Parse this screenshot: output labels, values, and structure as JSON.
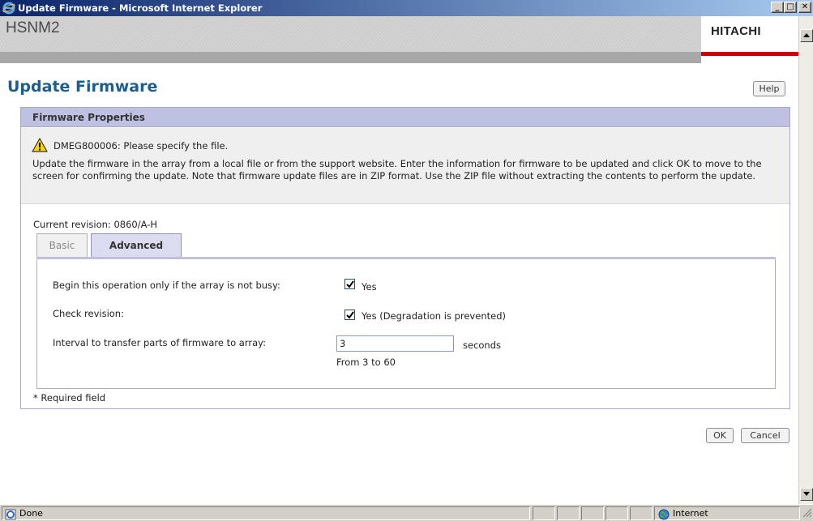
{
  "window": {
    "title": "Update Firmware - Microsoft Internet Explorer",
    "minimize_glyph": "_",
    "maximize_glyph": "□",
    "close_glyph": "✕"
  },
  "header": {
    "app_name": "HSNM2",
    "brand": "HITACHI"
  },
  "page": {
    "title": "Update Firmware",
    "help_label": "Help"
  },
  "panel": {
    "title": "Firmware Properties",
    "warning": "DMEG800006: Please specify the file.",
    "description": "Update the firmware in the array from a local file or from the support website.  Enter the information for firmware to be updated and click OK to move to the screen for confirming the update.  Note that firmware update files are in ZIP format. Use the ZIP file without extracting the contents to perform the update.",
    "current_revision": "Current revision: 0860/A-H",
    "tabs": [
      {
        "label": "Basic",
        "selected": false
      },
      {
        "label": "Advanced",
        "selected": true
      }
    ],
    "options": {
      "busy_label": "Begin this operation only if the array is not busy:",
      "busy_checked": true,
      "busy_value": "Yes",
      "check_revision_label": "Check revision:",
      "check_revision_checked": true,
      "check_revision_value": "Yes  (Degradation is prevented)",
      "interval_label": "Interval to transfer parts of firmware to array:",
      "interval_value": "3",
      "interval_unit": "seconds",
      "interval_range": "From 3 to 60"
    },
    "required_note": "* Required field"
  },
  "buttons": {
    "ok": "OK",
    "cancel": "Cancel"
  },
  "statusbar": {
    "status": "Done",
    "zone": "Internet"
  },
  "colors": {
    "title_blue": "#1b5e8f",
    "panel_header": "#bfc1e2",
    "brand_red": "#cc0000"
  }
}
